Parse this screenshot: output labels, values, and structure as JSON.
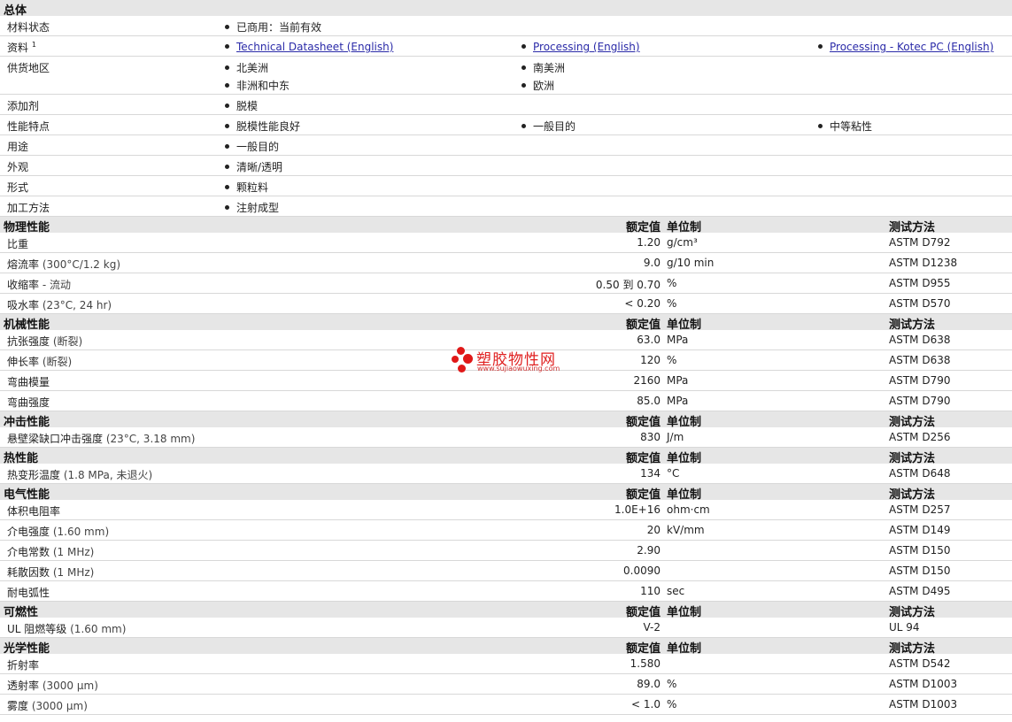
{
  "general": {
    "title": "总体",
    "rows": [
      {
        "label": "材料状态",
        "items": [
          "已商用：当前有效"
        ]
      },
      {
        "label": "资料",
        "sup": "1",
        "links": [
          "Technical Datasheet (English)",
          "Processing (English)",
          "Processing - Kotec PC (English)"
        ]
      },
      {
        "label": "供货地区",
        "items": [
          "北美洲",
          "南美洲",
          "非洲和中东",
          "欧洲"
        ]
      },
      {
        "label": "添加剂",
        "items": [
          "脱模"
        ]
      },
      {
        "label": "性能特点",
        "items": [
          "脱模性能良好",
          "一般目的",
          "中等粘性"
        ]
      },
      {
        "label": "用途",
        "items": [
          "一般目的"
        ]
      },
      {
        "label": "外观",
        "items": [
          "清晰/透明"
        ]
      },
      {
        "label": "形式",
        "items": [
          "颗粒料"
        ]
      },
      {
        "label": "加工方法",
        "items": [
          "注射成型"
        ]
      }
    ]
  },
  "headers": {
    "value": "额定值",
    "unit": "单位制",
    "method": "测试方法"
  },
  "sections": [
    {
      "title": "物理性能",
      "rows": [
        {
          "label": "比重",
          "cond": "",
          "value": "1.20",
          "unit": "g/cm³",
          "method": "ASTM D792"
        },
        {
          "label": "熔流率",
          "cond": "(300°C/1.2 kg)",
          "value": "9.0",
          "unit": "g/10 min",
          "method": "ASTM D1238"
        },
        {
          "label": "收缩率",
          "cond": "- 流动",
          "value": "0.50 到  0.70",
          "unit": "%",
          "method": "ASTM D955"
        },
        {
          "label": "吸水率",
          "cond": "(23°C, 24 hr)",
          "value": "< 0.20",
          "unit": "%",
          "method": "ASTM D570"
        }
      ]
    },
    {
      "title": "机械性能",
      "rows": [
        {
          "label": "抗张强度",
          "cond": "(断裂)",
          "value": "63.0",
          "unit": "MPa",
          "method": "ASTM D638"
        },
        {
          "label": "伸长率",
          "cond": "(断裂)",
          "value": "120",
          "unit": "%",
          "method": "ASTM D638"
        },
        {
          "label": "弯曲模量",
          "cond": "",
          "value": "2160",
          "unit": "MPa",
          "method": "ASTM D790"
        },
        {
          "label": "弯曲强度",
          "cond": "",
          "value": "85.0",
          "unit": "MPa",
          "method": "ASTM D790"
        }
      ]
    },
    {
      "title": "冲击性能",
      "rows": [
        {
          "label": "悬壁梁缺口冲击强度",
          "cond": "(23°C, 3.18 mm)",
          "value": "830",
          "unit": "J/m",
          "method": "ASTM D256"
        }
      ]
    },
    {
      "title": "热性能",
      "rows": [
        {
          "label": "热变形温度",
          "cond": "(1.8 MPa, 未退火)",
          "value": "134",
          "unit": "°C",
          "method": "ASTM D648"
        }
      ]
    },
    {
      "title": "电气性能",
      "rows": [
        {
          "label": "体积电阻率",
          "cond": "",
          "value": "1.0E+16",
          "unit": "ohm·cm",
          "method": "ASTM D257"
        },
        {
          "label": "介电强度",
          "cond": "(1.60 mm)",
          "value": "20",
          "unit": "kV/mm",
          "method": "ASTM D149"
        },
        {
          "label": "介电常数",
          "cond": "(1 MHz)",
          "value": "2.90",
          "unit": "",
          "method": "ASTM D150"
        },
        {
          "label": "耗散因数",
          "cond": "(1 MHz)",
          "value": "0.0090",
          "unit": "",
          "method": "ASTM D150"
        },
        {
          "label": "耐电弧性",
          "cond": "",
          "value": "110",
          "unit": "sec",
          "method": "ASTM D495"
        }
      ]
    },
    {
      "title": "可燃性",
      "rows": [
        {
          "label": "UL 阻燃等级",
          "cond": "(1.60 mm)",
          "value": "V-2",
          "unit": "",
          "method": "UL 94"
        }
      ]
    },
    {
      "title": "光学性能",
      "rows": [
        {
          "label": "折射率",
          "cond": "",
          "value": "1.580",
          "unit": "",
          "method": "ASTM D542"
        },
        {
          "label": "透射率",
          "cond": "(3000 µm)",
          "value": "89.0",
          "unit": "%",
          "method": "ASTM D1003"
        },
        {
          "label": "雾度",
          "cond": "(3000 µm)",
          "value": "< 1.0",
          "unit": "%",
          "method": "ASTM D1003"
        }
      ]
    }
  ],
  "watermark": {
    "name": "塑胶物性网",
    "url": "www.sujiaowuxing.com",
    "color": "#e02020"
  }
}
